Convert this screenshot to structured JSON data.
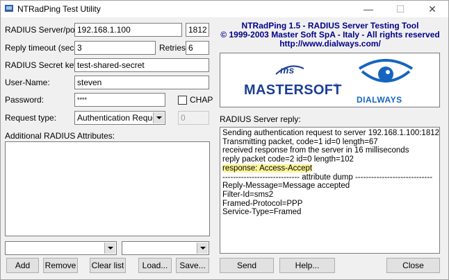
{
  "window": {
    "title": "NTRadPing Test Utility",
    "minimize": "—",
    "maximize": "☐",
    "close": "✕"
  },
  "form": {
    "server_label": "RADIUS Server/port:",
    "server_value": "192.168.1.100",
    "port_value": "1812",
    "timeout_label": "Reply timeout (sec.):",
    "timeout_value": "3",
    "retries_label": "Retries:",
    "retries_value": "6",
    "secret_label": "RADIUS Secret key:",
    "secret_value": "test-shared-secret",
    "username_label": "User-Name:",
    "username_value": "steven",
    "password_label": "Password:",
    "password_value": "****",
    "chap_label": "CHAP",
    "chap_checked": false,
    "request_type_label": "Request type:",
    "request_type_value": "Authentication Request",
    "request_number_value": "0",
    "attributes_label": "Additional RADIUS Attributes:",
    "attr_select1_value": "",
    "attr_select2_value": ""
  },
  "header": {
    "line1": "NTRadPing 1.5 - RADIUS Server Testing Tool",
    "line2": "© 1999-2003 Master Soft SpA - Italy - All rights reserved",
    "line3": "http://www.dialways.com/"
  },
  "logos": {
    "ms": "ms",
    "mastersoft": "MASTERSOFT",
    "registered": "®",
    "dialways": "DIALWAYS"
  },
  "reply": {
    "label": "RADIUS Server reply:",
    "lines": [
      "Sending authentication request to server 192.168.1.100:1812",
      "Transmitting packet, code=1 id=0 length=67",
      "received response from the server in 16 milliseconds",
      "reply packet code=2 id=0 length=102",
      "response: Access-Accept",
      "----------------------------- attribute dump -----------------------------",
      "Reply-Message=Message accepted",
      "Filter-Id=sms2",
      "Framed-Protocol=PPP",
      "Service-Type=Framed"
    ]
  },
  "buttons": {
    "add": "Add",
    "remove": "Remove",
    "clear_list": "Clear list",
    "load": "Load...",
    "save": "Save...",
    "send": "Send",
    "help": "Help...",
    "close": "Close"
  },
  "colors": {
    "header_text": "#00008b",
    "highlight": "#fbf59b",
    "mastersoft_blue": "#1c3f94",
    "dialways_blue": "#1565c0"
  }
}
